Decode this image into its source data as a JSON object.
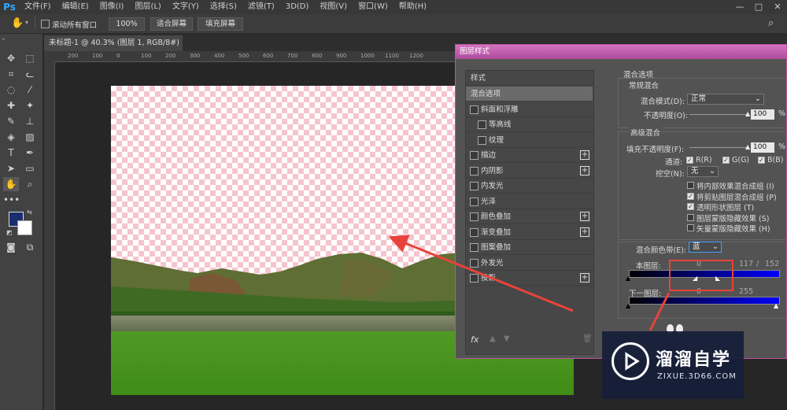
{
  "app": {
    "logo": "Ps"
  },
  "menubar": {
    "items": [
      "文件(F)",
      "编辑(E)",
      "图像(I)",
      "图层(L)",
      "文字(Y)",
      "选择(S)",
      "滤镜(T)",
      "3D(D)",
      "视图(V)",
      "窗口(W)",
      "帮助(H)"
    ],
    "window_controls": [
      "—",
      "□",
      "✕"
    ]
  },
  "options_bar": {
    "scroll_all_label": "滚动所有窗口",
    "zoom_value": "100%",
    "fit_screen": "适合屏幕",
    "fill_screen": "填充屏幕"
  },
  "document": {
    "tab_title": "未标题-1 @ 40.3% (图层 1, RGB/8#) *",
    "ruler_ticks": [
      "200",
      "100",
      "0",
      "100",
      "200",
      "300",
      "400",
      "500",
      "600",
      "700",
      "800",
      "900",
      "1000",
      "1100",
      "1200"
    ]
  },
  "icons": {
    "move": "move-icon",
    "marquee": "marquee-icon",
    "crop": "crop-icon",
    "lasso": "lasso-icon",
    "brush": "brush-icon",
    "eyedropper": "eyedropper-icon",
    "stamp": "stamp-icon",
    "eraser": "eraser-icon",
    "text": "text-icon",
    "pen": "pen-icon",
    "hand": "hand-icon",
    "zoom": "zoom-icon",
    "search": "search-icon"
  },
  "colors": {
    "foreground": "#1a2d6e",
    "background": "#ffffff",
    "dialog_title": "#c050a0",
    "arrow": "#e8433a"
  },
  "dialog": {
    "title": "图层样式",
    "style_list": {
      "header": "样式",
      "items": [
        {
          "label": "混合选项",
          "selected": true,
          "checkbox": false,
          "plus": false,
          "indent": 0
        },
        {
          "label": "斜面和浮雕",
          "checkbox": true,
          "plus": false,
          "indent": 0
        },
        {
          "label": "等高线",
          "checkbox": true,
          "plus": false,
          "indent": 1
        },
        {
          "label": "纹理",
          "checkbox": true,
          "plus": false,
          "indent": 1
        },
        {
          "label": "描边",
          "checkbox": true,
          "plus": true,
          "indent": 0
        },
        {
          "label": "内阴影",
          "checkbox": true,
          "plus": true,
          "indent": 0
        },
        {
          "label": "内发光",
          "checkbox": true,
          "plus": false,
          "indent": 0
        },
        {
          "label": "光泽",
          "checkbox": true,
          "plus": false,
          "indent": 0
        },
        {
          "label": "颜色叠加",
          "checkbox": true,
          "plus": true,
          "indent": 0
        },
        {
          "label": "渐变叠加",
          "checkbox": true,
          "plus": true,
          "indent": 0
        },
        {
          "label": "图案叠加",
          "checkbox": true,
          "plus": false,
          "indent": 0
        },
        {
          "label": "外发光",
          "checkbox": true,
          "plus": false,
          "indent": 0
        },
        {
          "label": "投影",
          "checkbox": true,
          "plus": true,
          "indent": 0
        }
      ],
      "footer_fx": "fx"
    },
    "blend_options": {
      "title": "混合选项",
      "general_title": "常规混合",
      "blend_mode_label": "混合模式(D):",
      "blend_mode_value": "正常",
      "opacity_label": "不透明度(O):",
      "opacity_value": "100",
      "opacity_unit": "%",
      "opacity_level": 1.0,
      "advanced_title": "高级混合",
      "fill_opacity_label": "填充不透明度(F):",
      "fill_opacity_value": "100",
      "fill_unit": "%",
      "fill_level": 1.0,
      "channels_label": "通道:",
      "channel_r": "R(R)",
      "channel_g": "G(G)",
      "channel_b": "B(B)",
      "knockout_label": "挖空(N):",
      "knockout_value": "无",
      "options": [
        {
          "label": "将内部效果混合成组 (I)",
          "checked": false
        },
        {
          "label": "将剪贴图层混合成组 (P)",
          "checked": true
        },
        {
          "label": "透明形状图层 (T)",
          "checked": true
        },
        {
          "label": "图层蒙版隐藏效果 (S)",
          "checked": false
        },
        {
          "label": "矢量蒙版隐藏效果 (H)",
          "checked": false
        }
      ],
      "blend_if_label": "混合颜色带(E):",
      "blend_if_value": "蓝",
      "this_layer_label": "本图层:",
      "this_layer_left": "0",
      "this_layer_mid": "117",
      "this_layer_sep": "/",
      "this_layer_right": "152",
      "underlying_label": "下一图层:",
      "underlying_left": "0",
      "underlying_right": "255"
    }
  },
  "watermark": {
    "title": "溜溜自学",
    "url": "ZIXUE.3D66.COM"
  }
}
